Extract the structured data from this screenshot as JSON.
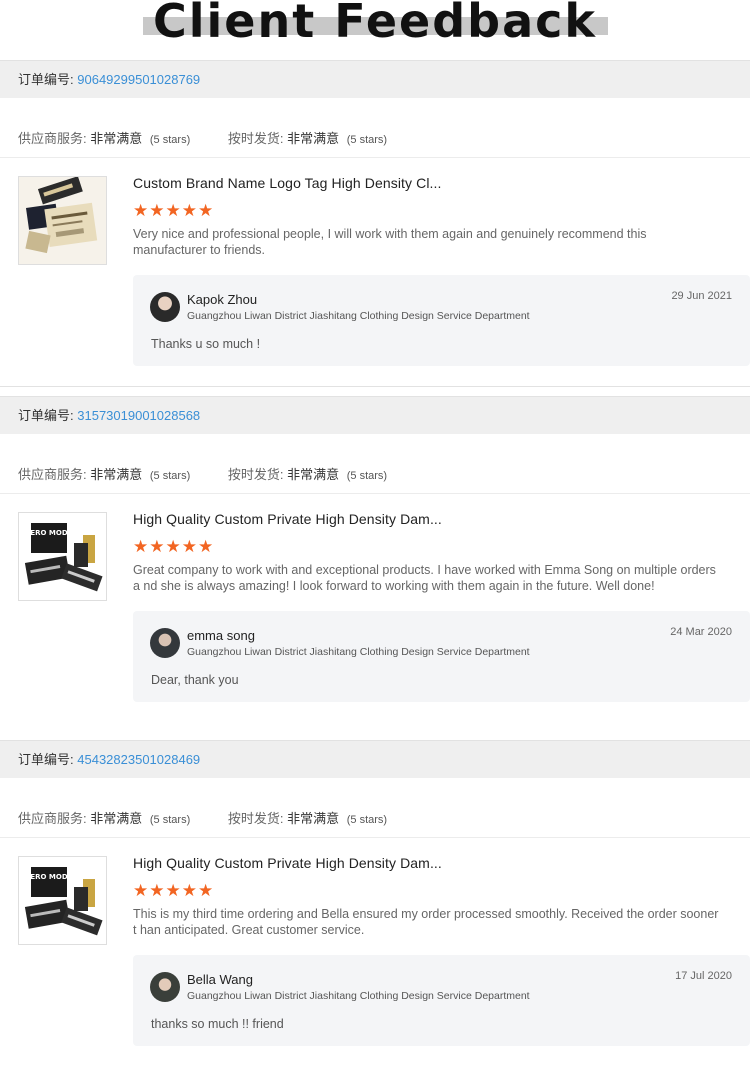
{
  "header": {
    "title": "Client Feedback"
  },
  "colors": {
    "accent_star": "#f26522",
    "order_link": "#3a8fd6",
    "order_bar_bg": "#efefef"
  },
  "reviews": [
    {
      "order_label": "订单编号:",
      "order_number": "90649299501028769",
      "supplier_service_label": "供应商服务:",
      "supplier_service_value": "非常满意",
      "supplier_service_stars": "(5 stars)",
      "shipping_label": "按时发货:",
      "shipping_value": "非常满意",
      "shipping_stars": "(5 stars)",
      "product_title": "Custom Brand Name Logo Tag High Density Cl...",
      "rating": "5",
      "comment": "Very nice and professional people, I will work with them again and genuinely recommend this manufacturer to friends.",
      "reply": {
        "name": "Kapok Zhou",
        "company": "Guangzhou Liwan District Jiashitang Clothing Design Service Department",
        "date": "29 Jun 2021",
        "text": "Thanks u so much !"
      },
      "thumb_icon": "woven-label-beige"
    },
    {
      "order_label": "订单编号:",
      "order_number": "31573019001028568",
      "supplier_service_label": "供应商服务:",
      "supplier_service_value": "非常满意",
      "supplier_service_stars": "(5 stars)",
      "shipping_label": "按时发货:",
      "shipping_value": "非常满意",
      "shipping_stars": "(5 stars)",
      "product_title": "High Quality Custom Private High Density Dam...",
      "rating": "5",
      "comment": "Great company to work with and exceptional products. I have worked with Emma Song on multiple orders a nd she is always amazing! I look forward to working with them again in the future. Well done!",
      "reply": {
        "name": "emma song",
        "company": "Guangzhou Liwan District Jiashitang Clothing Design Service Department",
        "date": "24 Mar 2020",
        "text": "Dear, thank you"
      },
      "thumb_icon": "woven-label-black",
      "thumb_text": "VERO MODA"
    },
    {
      "order_label": "订单编号:",
      "order_number": "45432823501028469",
      "supplier_service_label": "供应商服务:",
      "supplier_service_value": "非常满意",
      "supplier_service_stars": "(5 stars)",
      "shipping_label": "按时发货:",
      "shipping_value": "非常满意",
      "shipping_stars": "(5 stars)",
      "product_title": "High Quality Custom Private High Density Dam...",
      "rating": "5",
      "comment": "This is my third time ordering and Bella ensured my order processed smoothly. Received the order sooner t han anticipated. Great customer service.",
      "reply": {
        "name": "Bella Wang",
        "company": "Guangzhou Liwan District Jiashitang Clothing Design Service Department",
        "date": "17 Jul 2020",
        "text": "thanks so much !! friend"
      },
      "thumb_icon": "woven-label-black",
      "thumb_text": "VERO MODA"
    }
  ]
}
